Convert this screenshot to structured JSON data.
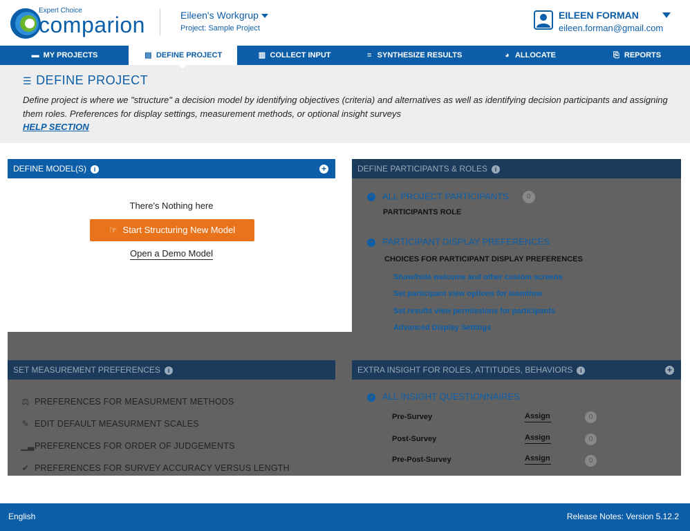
{
  "brand": {
    "top": "Expert Choice",
    "name": "comparion"
  },
  "workgroup": {
    "name": "Eileen's Workgrup",
    "project": "Project: Sample Project"
  },
  "user": {
    "name": "EILEEN FORMAN",
    "email": "eileen.forman@gmail.com"
  },
  "nav": {
    "items": [
      {
        "label": "MY PROJECTS",
        "icon": "folder-icon"
      },
      {
        "label": "DEFINE PROJECT",
        "icon": "copy-icon",
        "active": true
      },
      {
        "label": "COLLECT INPUT",
        "icon": "bar-chart-icon"
      },
      {
        "label": "SYNTHESIZE RESULTS",
        "icon": "database-icon"
      },
      {
        "label": "ALLOCATE",
        "icon": "pie-chart-icon"
      },
      {
        "label": "REPORTS",
        "icon": "report-icon"
      }
    ]
  },
  "banner": {
    "title": "DEFINE PROJECT",
    "description": "Define project is where we \"structure\" a decision model by identifying objectives (criteria) and alternatives as well as identifying decision participants and assigning them roles. Preferences for display settings, measurement methods, or optional insight surveys",
    "help_link": "HELP SECTION"
  },
  "define_models": {
    "title": "DEFINE MODEL(S)",
    "empty_text": "There's Nothing here",
    "start_button": "Start Structuring New Model",
    "demo_link": "Open a Demo Model"
  },
  "participants": {
    "title": "DEFINE PARTICIPANTS & ROLES",
    "all_participants": "ALL PROJECT PARTICIPANTS",
    "all_participants_count": "0",
    "participants_role": "PARTICIPANTS ROLE",
    "display_prefs": "PARTICIPANT DISPLAY PREFERENCES",
    "display_choices": "CHOICES FOR PARTICIPANT DISPLAY PREFERENCES",
    "links": [
      "Show/hide welcome and other custom screens",
      "Set participant view options for teamtime",
      "Set results view permissions for participants",
      "Advanced Display Settings"
    ]
  },
  "measurement": {
    "title": "SET MEASUREMENT PREFERENCES",
    "items": [
      {
        "label": "PREFERENCES FOR MEASURMENT METHODS",
        "icon": "balance-scale-icon"
      },
      {
        "label": "EDIT DEFAULT MEASURMENT SCALES",
        "icon": "edit-icon"
      },
      {
        "label": "PREFERENCES FOR ORDER OF JUDGEMENTS",
        "icon": "signal-icon"
      },
      {
        "label": "PREFERENCES FOR SURVEY ACCURACY VERSUS LENGTH",
        "icon": "check-icon"
      }
    ]
  },
  "insight": {
    "title": "EXTRA INSIGHT FOR ROLES, ATTITUDES, BEHAVIORS",
    "section": "ALL INSIGHT QUESTIONNAIRES",
    "assign_label": "Assign",
    "rows": [
      {
        "label": "Pre-Survey",
        "count": "0"
      },
      {
        "label": "Post-Survey",
        "count": "0"
      },
      {
        "label": "Pre-Post-Survey",
        "count": "0"
      }
    ]
  },
  "footer": {
    "language": "English",
    "version": "Release Notes: Version 5.12.2"
  },
  "colors": {
    "primary": "#0d5ea8",
    "accent": "#e8731a",
    "overlay": "#555555"
  }
}
